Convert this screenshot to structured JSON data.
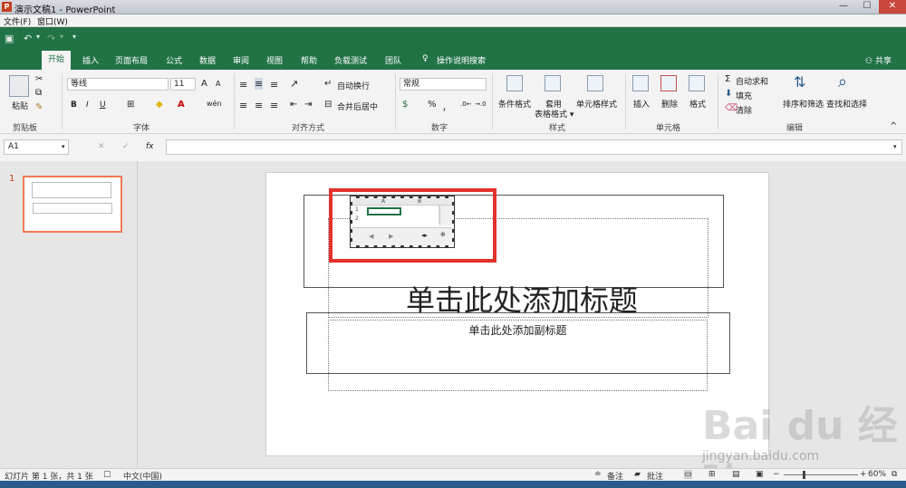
{
  "window": {
    "title": "演示文稿1 - PowerPoint",
    "app_icon": "P"
  },
  "menubar": [
    "文件(F)",
    "窗口(W)"
  ],
  "tabs": [
    "开始",
    "插入",
    "页面布局",
    "公式",
    "数据",
    "审阅",
    "视图",
    "帮助",
    "负载测试",
    "团队",
    "操作说明搜索"
  ],
  "share": "共享",
  "ribbon": {
    "clipboard": {
      "paste": "粘贴",
      "label": "剪贴板"
    },
    "font": {
      "name": "等线",
      "size": "11",
      "label": "字体",
      "bold": "B",
      "italic": "I",
      "underline": "U",
      "grow": "A",
      "shrink": "A",
      "color": "A"
    },
    "alignment": {
      "wrap": "自动换行",
      "merge": "合并后居中",
      "label": "对齐方式"
    },
    "number": {
      "format": "常规",
      "percent": "%",
      "comma": "，",
      "label": "数字"
    },
    "styles": {
      "conditional": "条件格式",
      "table": "套用\n表格格式",
      "cell": "单元格样式",
      "label": "样式"
    },
    "cells": {
      "insert": "插入",
      "delete": "删除",
      "format": "格式",
      "label": "单元格"
    },
    "editing": {
      "autosum": "自动求和",
      "fill": "填充",
      "clear": "清除",
      "sort": "排序和筛选",
      "find": "查找和选择",
      "label": "编辑"
    }
  },
  "formulabar": {
    "namebox": "A1",
    "fx": "fx",
    "value": ""
  },
  "thumbnail": {
    "number": "1"
  },
  "slide": {
    "title_placeholder": "单击此处添加标题",
    "subtitle_placeholder": "单击此处添加副标题",
    "embedded_sheet": {
      "columns": [
        "A",
        "B"
      ],
      "rows": [
        "1",
        "2"
      ]
    }
  },
  "status": {
    "slide_info": "幻灯片 第 1 张，共 1 张",
    "language": "中文(中国)",
    "notes": "备注",
    "comments": "批注",
    "zoom": "60%"
  },
  "watermark": {
    "brand": "Bai du 经验",
    "url": "jingyan.baidu.com"
  }
}
